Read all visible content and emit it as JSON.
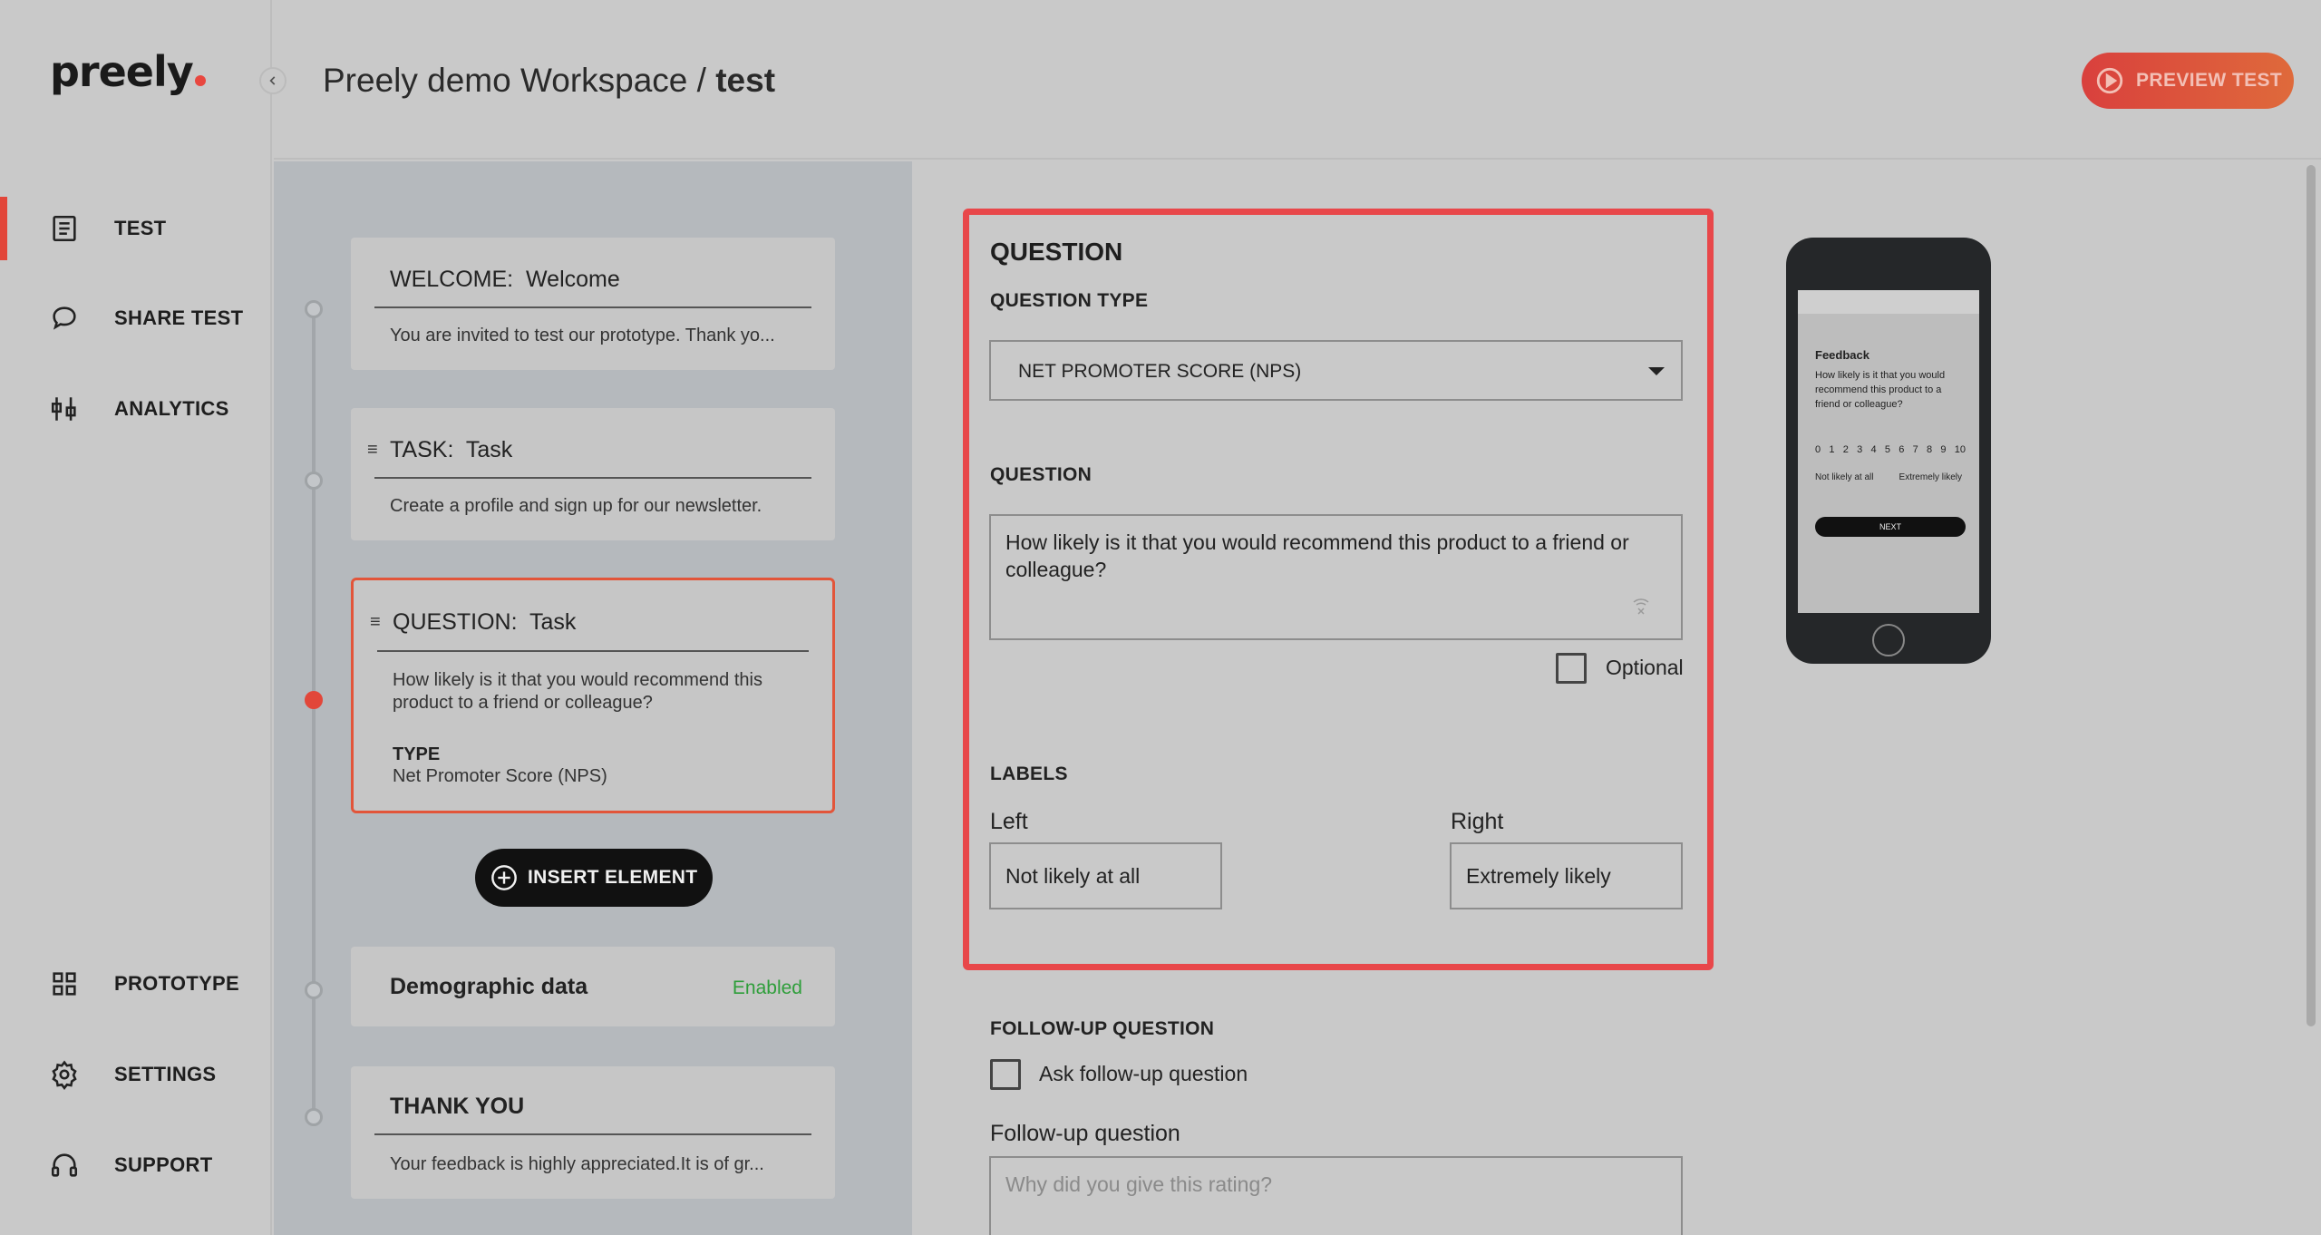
{
  "app": {
    "logo": "preely"
  },
  "header": {
    "workspace": "Preely demo Workspace /",
    "test_name": "test",
    "preview_label": "PREVIEW TEST"
  },
  "sidebar": {
    "top_items": [
      {
        "label": "TEST",
        "icon": "document-icon",
        "active": true
      },
      {
        "label": "SHARE TEST",
        "icon": "speech-bubble-icon"
      },
      {
        "label": "ANALYTICS",
        "icon": "analytics-icon"
      }
    ],
    "bottom_items": [
      {
        "label": "PROTOTYPE",
        "icon": "grid-icon"
      },
      {
        "label": "SETTINGS",
        "icon": "gear-icon"
      },
      {
        "label": "SUPPORT",
        "icon": "headset-icon"
      }
    ]
  },
  "flow": {
    "welcome": {
      "kind": "WELCOME:",
      "name": "Welcome",
      "text": "You are invited to test our prototype. Thank yo..."
    },
    "task": {
      "kind": "TASK:",
      "name": "Task",
      "text": "Create a profile and sign up for our newsletter."
    },
    "question": {
      "kind": "QUESTION:",
      "name": "Task",
      "text": "How likely is it that you would recommend this product to a friend or colleague?",
      "type_label": "TYPE",
      "type_value": "Net Promoter Score (NPS)"
    },
    "insert_label": "INSERT ELEMENT",
    "demographic": {
      "label": "Demographic data",
      "status": "Enabled"
    },
    "thankyou": {
      "kind": "THANK YOU",
      "text": "Your feedback is highly appreciated.It is of gr..."
    }
  },
  "editor": {
    "heading": "QUESTION",
    "question_type_label": "QUESTION TYPE",
    "question_type_value": "NET PROMOTER SCORE (NPS)",
    "question_label": "QUESTION",
    "question_text": "How likely is it that you would recommend this product to a friend or colleague?",
    "optional_label": "Optional",
    "labels_heading": "LABELS",
    "left_label": "Left",
    "left_value": "Not likely at all",
    "right_label": "Right",
    "right_value": "Extremely likely",
    "followup_heading": "FOLLOW-UP QUESTION",
    "followup_checkbox_label": "Ask follow-up question",
    "followup_field_label": "Follow-up question",
    "followup_placeholder": "Why did you give this rating?"
  },
  "phone_preview": {
    "title": "Feedback",
    "question": "How likely is it that you would recommend this product to a friend or colleague?",
    "scale": [
      "0",
      "1",
      "2",
      "3",
      "4",
      "5",
      "6",
      "7",
      "8",
      "9",
      "10"
    ],
    "left": "Not likely at all",
    "right": "Extremely likely",
    "next": "NEXT"
  },
  "colors": {
    "accent": "#e2463a",
    "enabled": "#2e9e3a"
  }
}
